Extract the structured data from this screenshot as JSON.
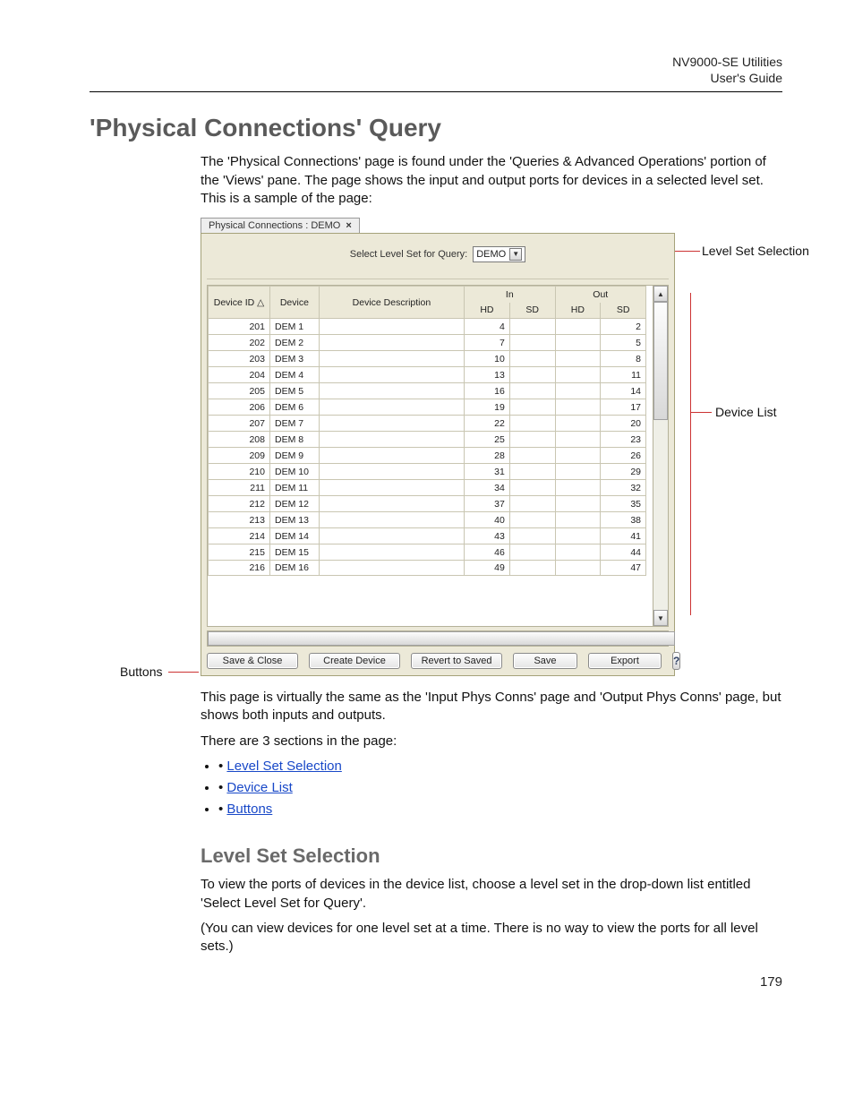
{
  "doc_header": {
    "product": "NV9000-SE Utilities",
    "subtitle": "User's Guide"
  },
  "title": "'Physical Connections' Query",
  "intro": "The 'Physical Connections' page is found under the 'Queries & Advanced Operations' portion of the 'Views' pane. The page shows the input and output ports for devices in a selected level set. This is a sample of the page:",
  "tab": {
    "label": "Physical Connections : DEMO",
    "close": "×"
  },
  "query_bar": {
    "label": "Select Level Set for Query:",
    "value": "DEMO"
  },
  "columns": {
    "device_id": "Device ID",
    "sort_glyph": "△",
    "device": "Device",
    "desc": "Device Description",
    "in": "In",
    "out": "Out",
    "hd": "HD",
    "sd": "SD"
  },
  "rows": [
    {
      "id": "201",
      "dev": "DEM 1",
      "desc": "",
      "in_hd": "4",
      "in_sd": "",
      "out_hd": "",
      "out_sd": "2"
    },
    {
      "id": "202",
      "dev": "DEM 2",
      "desc": "",
      "in_hd": "7",
      "in_sd": "",
      "out_hd": "",
      "out_sd": "5"
    },
    {
      "id": "203",
      "dev": "DEM 3",
      "desc": "",
      "in_hd": "10",
      "in_sd": "",
      "out_hd": "",
      "out_sd": "8"
    },
    {
      "id": "204",
      "dev": "DEM 4",
      "desc": "",
      "in_hd": "13",
      "in_sd": "",
      "out_hd": "",
      "out_sd": "11"
    },
    {
      "id": "205",
      "dev": "DEM 5",
      "desc": "",
      "in_hd": "16",
      "in_sd": "",
      "out_hd": "",
      "out_sd": "14"
    },
    {
      "id": "206",
      "dev": "DEM 6",
      "desc": "",
      "in_hd": "19",
      "in_sd": "",
      "out_hd": "",
      "out_sd": "17"
    },
    {
      "id": "207",
      "dev": "DEM 7",
      "desc": "",
      "in_hd": "22",
      "in_sd": "",
      "out_hd": "",
      "out_sd": "20"
    },
    {
      "id": "208",
      "dev": "DEM 8",
      "desc": "",
      "in_hd": "25",
      "in_sd": "",
      "out_hd": "",
      "out_sd": "23"
    },
    {
      "id": "209",
      "dev": "DEM 9",
      "desc": "",
      "in_hd": "28",
      "in_sd": "",
      "out_hd": "",
      "out_sd": "26"
    },
    {
      "id": "210",
      "dev": "DEM 10",
      "desc": "",
      "in_hd": "31",
      "in_sd": "",
      "out_hd": "",
      "out_sd": "29"
    },
    {
      "id": "211",
      "dev": "DEM 11",
      "desc": "",
      "in_hd": "34",
      "in_sd": "",
      "out_hd": "",
      "out_sd": "32"
    },
    {
      "id": "212",
      "dev": "DEM 12",
      "desc": "",
      "in_hd": "37",
      "in_sd": "",
      "out_hd": "",
      "out_sd": "35"
    },
    {
      "id": "213",
      "dev": "DEM 13",
      "desc": "",
      "in_hd": "40",
      "in_sd": "",
      "out_hd": "",
      "out_sd": "38"
    },
    {
      "id": "214",
      "dev": "DEM 14",
      "desc": "",
      "in_hd": "43",
      "in_sd": "",
      "out_hd": "",
      "out_sd": "41"
    },
    {
      "id": "215",
      "dev": "DEM 15",
      "desc": "",
      "in_hd": "46",
      "in_sd": "",
      "out_hd": "",
      "out_sd": "44"
    },
    {
      "id": "216",
      "dev": "DEM 16",
      "desc": "",
      "in_hd": "49",
      "in_sd": "",
      "out_hd": "",
      "out_sd": "47"
    }
  ],
  "buttons": {
    "save_close": "Save & Close",
    "create_device": "Create Device",
    "revert": "Revert to Saved",
    "save": "Save",
    "export": "Export",
    "help": "?"
  },
  "annotations": {
    "level_set": "Level Set Selection",
    "device_list": "Device List",
    "buttons": "Buttons"
  },
  "after_fig_p1": "This page is virtually the same as the 'Input Phys Conns' page and 'Output Phys Conns' page, but shows both inputs and outputs.",
  "after_fig_p2": "There are 3 sections in the page:",
  "links": {
    "lss": "Level Set Selection",
    "dl": "Device List",
    "bt": "Buttons"
  },
  "section2_title": "Level Set Selection",
  "section2_p1": "To view the ports of devices in the device list, choose a level set in the drop-down list entitled 'Select Level Set for Query'.",
  "section2_p2": "(You can view devices for one level set at a time. There is no way to view the ports for all level sets.)",
  "page_number": "179"
}
